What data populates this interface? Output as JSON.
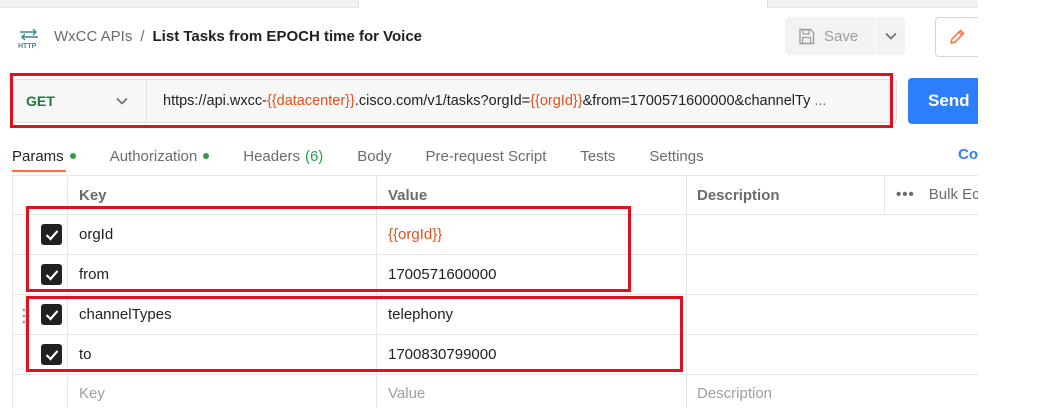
{
  "header": {
    "http_icon_label": "HTTP",
    "collection": "WxCC APIs",
    "separator": "/",
    "request_name": "List Tasks from EPOCH time for Voice",
    "save_label": "Save"
  },
  "request": {
    "method": "GET",
    "url_parts": {
      "p1": "https://api.wxcc-",
      "v1": "{{datacenter}}",
      "p2": ".cisco.com/v1/tasks?orgId=",
      "v2": "{{orgId}}",
      "p3": "&from=1700571600000&channelTy",
      "ellipsis": "..."
    },
    "send_label": "Send"
  },
  "tabs": [
    {
      "label": "Params"
    },
    {
      "label": "Authorization"
    },
    {
      "label": "Headers",
      "count": "(6)"
    },
    {
      "label": "Body"
    },
    {
      "label": "Pre-request Script"
    },
    {
      "label": "Tests"
    },
    {
      "label": "Settings"
    }
  ],
  "cookies_label": "Co",
  "table": {
    "headers": {
      "key": "Key",
      "value": "Value",
      "description": "Description"
    },
    "bulk_edit": "Bulk Ec",
    "bulk_dots": "•••",
    "rows": [
      {
        "key": "orgId",
        "value": "{{orgId}}"
      },
      {
        "key": "from",
        "value": "1700571600000"
      },
      {
        "key": "channelTypes",
        "value": "telephony"
      },
      {
        "key": "to",
        "value": "1700830799000"
      }
    ],
    "placeholder": {
      "key": "Key",
      "value": "Value",
      "description": "Description"
    }
  },
  "colors": {
    "accent": "#ff6c37",
    "send": "#2d7ff9",
    "variable": "#e2511f",
    "method_get": "#1d7a3e",
    "highlight": "#e0101f"
  }
}
